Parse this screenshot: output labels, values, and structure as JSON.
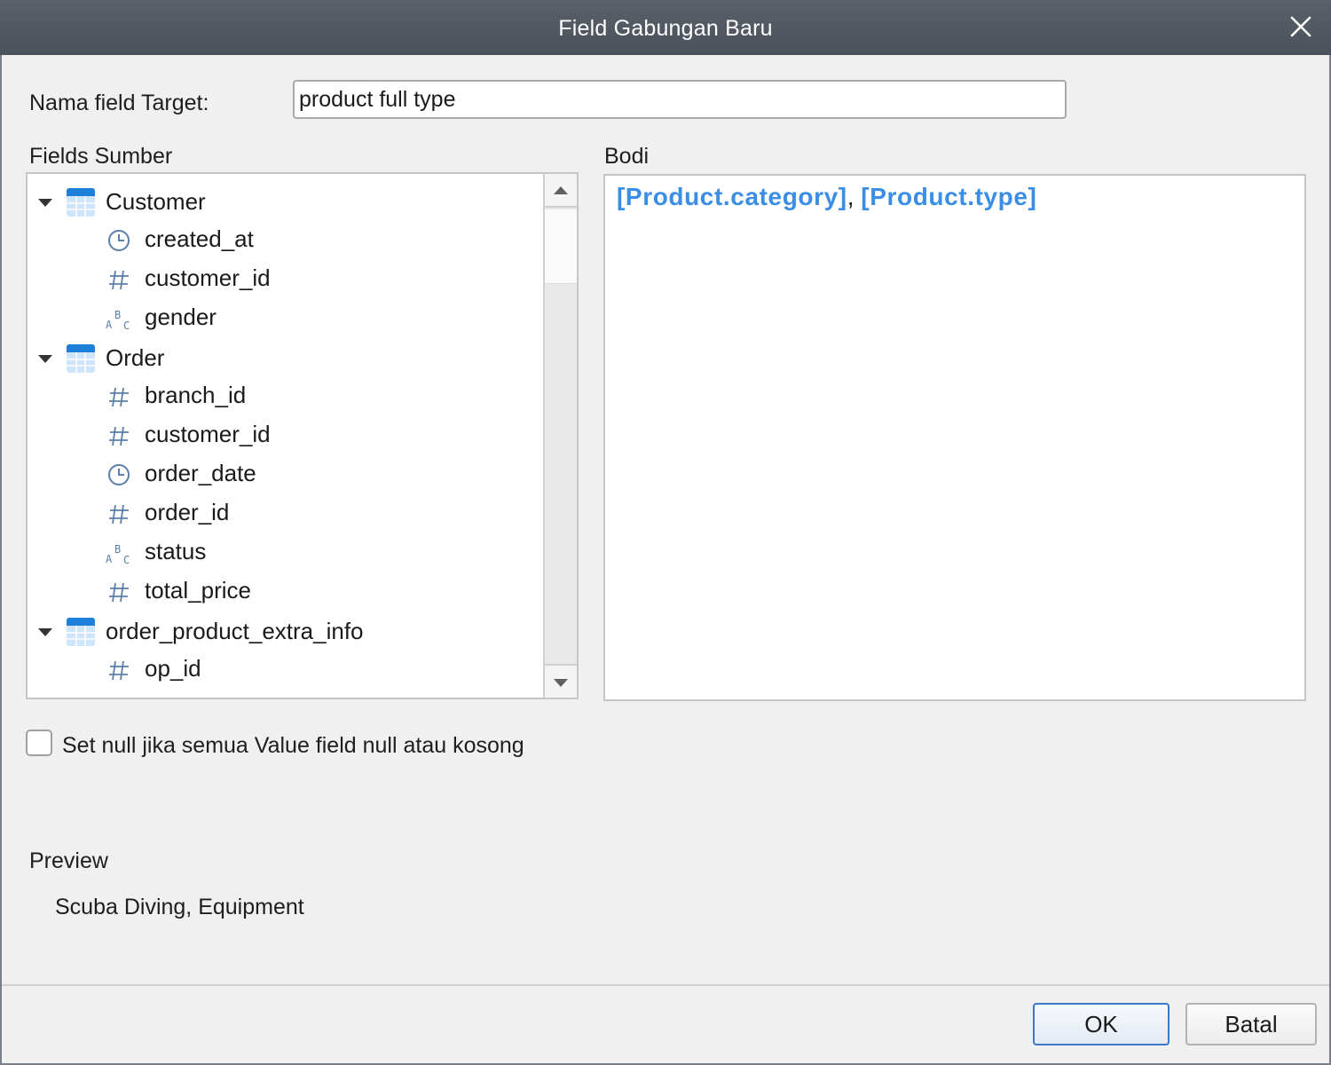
{
  "window": {
    "title": "Field Gabungan Baru"
  },
  "target": {
    "label": "Nama field Target:",
    "value": "product full type"
  },
  "source": {
    "label": "Fields Sumber",
    "groups": [
      {
        "name": "Customer",
        "fields": [
          {
            "name": "created_at",
            "type": "clock-icon"
          },
          {
            "name": "customer_id",
            "type": "number-icon"
          },
          {
            "name": "gender",
            "type": "text-icon"
          }
        ]
      },
      {
        "name": "Order",
        "fields": [
          {
            "name": "branch_id",
            "type": "number-icon"
          },
          {
            "name": "customer_id",
            "type": "number-icon"
          },
          {
            "name": "order_date",
            "type": "clock-icon"
          },
          {
            "name": "order_id",
            "type": "number-icon"
          },
          {
            "name": "status",
            "type": "text-icon"
          },
          {
            "name": "total_price",
            "type": "number-icon"
          }
        ]
      },
      {
        "name": "order_product_extra_info",
        "fields": [
          {
            "name": "op_id",
            "type": "number-icon"
          }
        ]
      }
    ]
  },
  "body": {
    "label": "Bodi",
    "token1": "[Product.category]",
    "separator": ", ",
    "token2": "[Product.type]"
  },
  "null_option": {
    "label": "Set null jika semua Value field null atau kosong",
    "checked": false
  },
  "preview": {
    "label": "Preview",
    "value": "Scuba Diving, Equipment"
  },
  "buttons": {
    "ok": "OK",
    "cancel": "Batal"
  },
  "colors": {
    "token": "#3b8ee6",
    "titlebar": "#525961",
    "icon": "#5a7fa8"
  }
}
